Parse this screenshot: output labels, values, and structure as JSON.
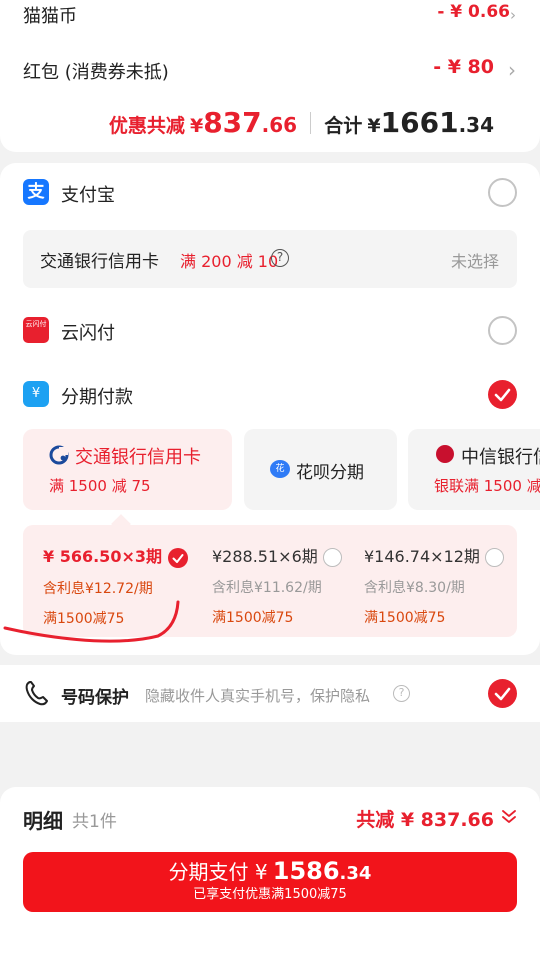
{
  "summary": {
    "cat_coin_label": "猫猫币",
    "cat_coin_value": "- ¥ 0.66",
    "redpacket_label": "红包 (消费券未抵)",
    "redpacket_value": "- ¥ 80",
    "discount_label": "优惠共减",
    "discount_currency": "¥",
    "discount_int": "837",
    "discount_dec": ".66",
    "total_label": "合计",
    "total_currency": "¥",
    "total_int": "1661",
    "total_dec": ".34"
  },
  "payment": {
    "alipay_label": "支付宝",
    "bank_name": "交通银行信用卡",
    "bank_promo": "满 200 减 10",
    "bank_state": "未选择",
    "unionpay_label": "云闪付",
    "unionpay_icon_text": "云闪付",
    "installment_label": "分期付款",
    "tiles": [
      {
        "name": "交通银行信用卡",
        "promo": "满 1500 减 75"
      },
      {
        "name": "花呗分期"
      },
      {
        "name": "中信银行信",
        "promo": "银联满 1500 减"
      }
    ],
    "plans": [
      {
        "price": "¥ 566.50×3期",
        "interest": "含利息¥12.72/期",
        "promo": "满1500减75"
      },
      {
        "price": "¥288.51×6期",
        "interest": "含利息¥11.62/期",
        "promo": "满1500减75"
      },
      {
        "price": "¥146.74×12期",
        "interest": "含利息¥8.30/期",
        "promo": "满1500减75"
      }
    ]
  },
  "phone_protect": {
    "label": "号码保护",
    "desc": "隐藏收件人真实手机号，保护隐私"
  },
  "footer": {
    "detail_label": "明细",
    "count_label": "共1件",
    "reduce_label": "共减 ¥ 837.66",
    "pay_label": "分期支付 ¥",
    "pay_int": "1586",
    "pay_dec": ".34",
    "pay_sub": "已享支付优惠满1500减75"
  },
  "colors": {
    "accent": "#e8202e",
    "promo": "#d9480f",
    "tile_selected_bg": "#fdeeee"
  },
  "icons": [
    "alipay-icon",
    "unionpay-icon",
    "installment-icon",
    "bank-of-communications-icon",
    "huabei-icon",
    "citic-bank-icon",
    "question-icon",
    "phone-icon",
    "check-icon",
    "chevron-right-icon",
    "chevron-double-down-icon"
  ]
}
